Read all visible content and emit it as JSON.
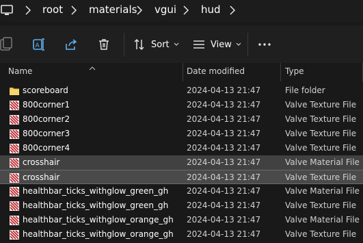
{
  "breadcrumb": {
    "items": [
      "root",
      "materials",
      "vgui",
      "hud"
    ]
  },
  "toolbar": {
    "sort_label": "Sort",
    "view_label": "View",
    "icons": [
      "new-item-icon",
      "rename-icon",
      "share-icon",
      "delete-icon",
      "sort-icon",
      "view-icon",
      "more-icon"
    ]
  },
  "columns": {
    "name": "Name",
    "date_modified": "Date modified",
    "type": "Type"
  },
  "files": [
    {
      "name": "scoreboard",
      "date": "2024-04-13 21:47",
      "type": "File folder",
      "icon": "folder-icon",
      "state": "normal"
    },
    {
      "name": "800corner1",
      "date": "2024-04-13 21:47",
      "type": "Valve Texture File",
      "icon": "texture-file-icon",
      "state": "normal"
    },
    {
      "name": "800corner2",
      "date": "2024-04-13 21:47",
      "type": "Valve Texture File",
      "icon": "texture-file-icon",
      "state": "normal"
    },
    {
      "name": "800corner3",
      "date": "2024-04-13 21:47",
      "type": "Valve Texture File",
      "icon": "texture-file-icon",
      "state": "normal"
    },
    {
      "name": "800corner4",
      "date": "2024-04-13 21:47",
      "type": "Valve Texture File",
      "icon": "texture-file-icon",
      "state": "normal"
    },
    {
      "name": "crosshair",
      "date": "2024-04-13 21:47",
      "type": "Valve Material File",
      "icon": "texture-file-icon",
      "state": "selected"
    },
    {
      "name": "crosshair",
      "date": "2024-04-13 21:47",
      "type": "Valve Texture File",
      "icon": "texture-file-icon",
      "state": "selected-focus"
    },
    {
      "name": "healthbar_ticks_withglow_green_gh",
      "date": "2024-04-13 21:47",
      "type": "Valve Material File",
      "icon": "texture-file-icon",
      "state": "normal"
    },
    {
      "name": "healthbar_ticks_withglow_green_gh",
      "date": "2024-04-13 21:47",
      "type": "Valve Texture File",
      "icon": "texture-file-icon",
      "state": "normal"
    },
    {
      "name": "healthbar_ticks_withglow_orange_gh",
      "date": "2024-04-13 21:47",
      "type": "Valve Material File",
      "icon": "texture-file-icon",
      "state": "normal"
    },
    {
      "name": "healthbar_ticks_withglow_orange_gh",
      "date": "2024-04-13 21:47",
      "type": "Valve Texture File",
      "icon": "texture-file-icon",
      "state": "normal"
    }
  ],
  "colors": {
    "background": "#191919",
    "selected": "#414141",
    "folder": "#f0c24b",
    "file_icon_accent": "#c0262d"
  }
}
